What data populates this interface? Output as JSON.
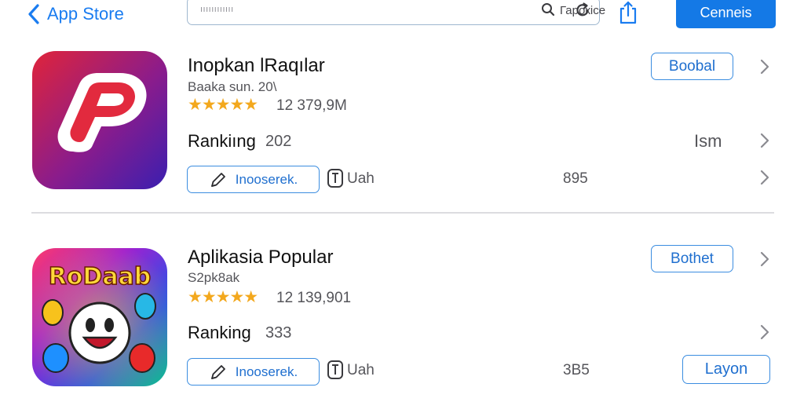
{
  "header": {
    "back_label": "App Store",
    "search_placeholder": "ıııııııııııı",
    "search_value": "Гарокісе",
    "cancel_label": "Cenneis"
  },
  "apps": [
    {
      "name": "Inopkan lRaqılar",
      "subtitle": "Baaka sun. 20\\",
      "stars": "★★★★★",
      "rating_count": "12 379,9M",
      "ranking_label": "Rankiıng",
      "ranking_value": "202",
      "action_label": "Boobal",
      "right_word": "Ism",
      "install_label": "Inooserek.",
      "flag_label": "Uah",
      "size": "895"
    },
    {
      "name": "Aplikasia Popular",
      "subtitle": "S2pk8ak",
      "stars": "★★★★★",
      "rating_count": "12 139,901",
      "ranking_label": "Ranking",
      "ranking_value": "333",
      "action_label": "Bothet",
      "install_label": "Inooserek.",
      "flag_label": "Uah",
      "size": "3B5",
      "layout_label": "Layon",
      "icon_text": "RoDaab"
    }
  ],
  "colors": {
    "accent": "#1479e6",
    "stars": "#f3a81d",
    "outline": "#3b8de0"
  }
}
